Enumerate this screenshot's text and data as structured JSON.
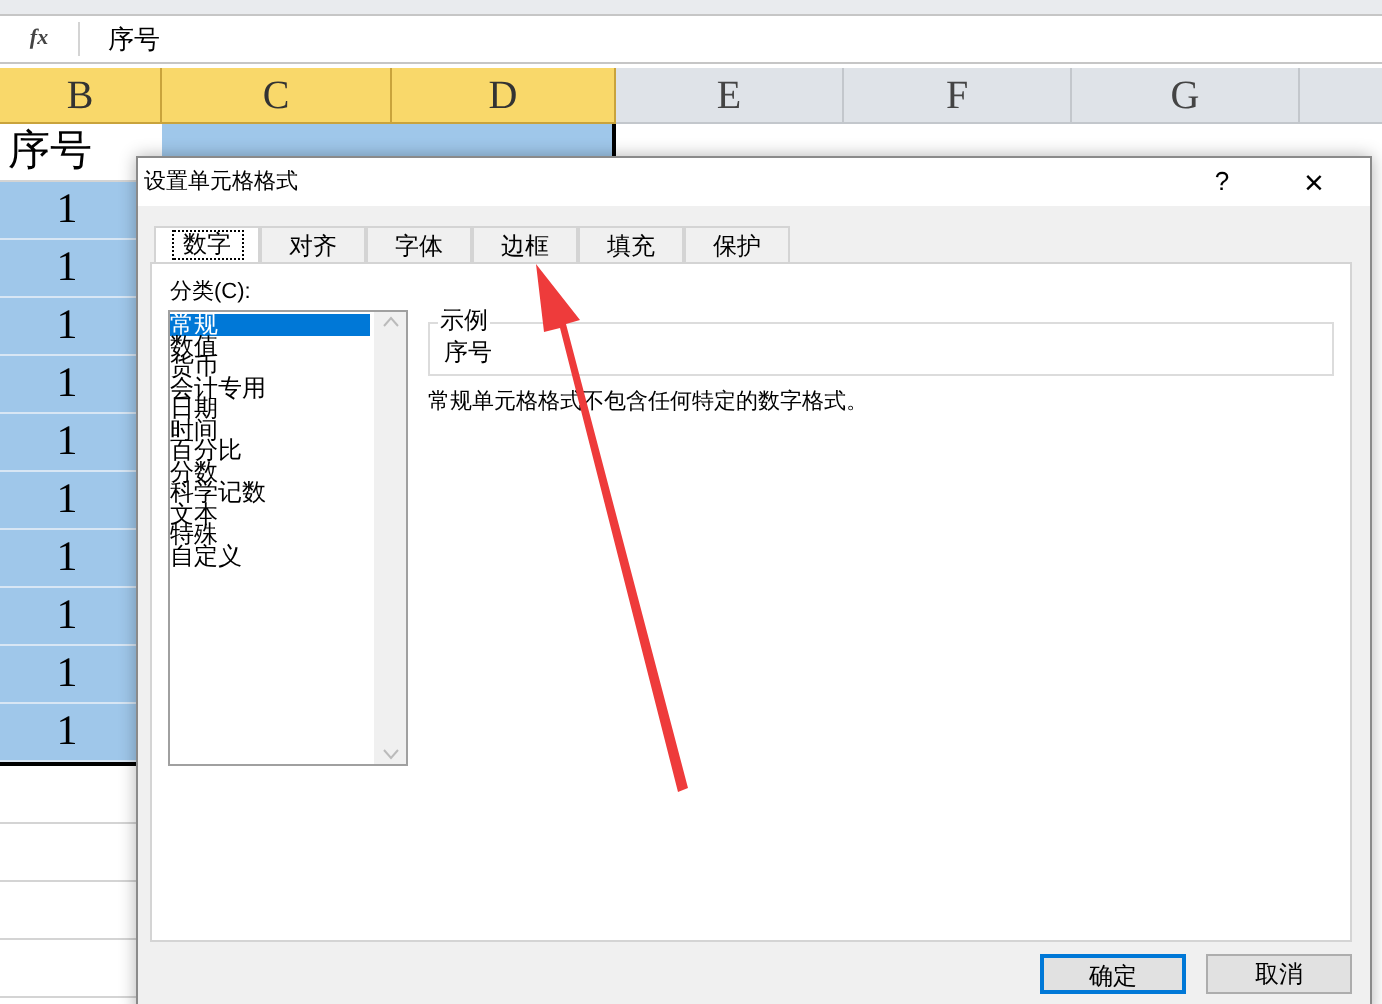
{
  "formula_bar": {
    "fx": "fx",
    "value": "序号"
  },
  "columns": [
    {
      "label": "B",
      "selected": true
    },
    {
      "label": "C",
      "selected": true
    },
    {
      "label": "D",
      "selected": true
    },
    {
      "label": "E",
      "selected": false
    },
    {
      "label": "F",
      "selected": false
    },
    {
      "label": "G",
      "selected": false
    }
  ],
  "column_b": [
    {
      "value": "序号",
      "selected": false
    },
    {
      "value": "1",
      "selected": true
    },
    {
      "value": "1",
      "selected": true
    },
    {
      "value": "1",
      "selected": true
    },
    {
      "value": "1",
      "selected": true
    },
    {
      "value": "1",
      "selected": true
    },
    {
      "value": "1",
      "selected": true
    },
    {
      "value": "1",
      "selected": true
    },
    {
      "value": "1",
      "selected": true
    },
    {
      "value": "1",
      "selected": true
    },
    {
      "value": "1",
      "selected": true
    }
  ],
  "dialog": {
    "title": "设置单元格格式",
    "help": "?",
    "close": "×",
    "tabs": [
      {
        "label": "数字",
        "selected": true
      },
      {
        "label": "对齐",
        "selected": false
      },
      {
        "label": "字体",
        "selected": false
      },
      {
        "label": "边框",
        "selected": false
      },
      {
        "label": "填充",
        "selected": false
      },
      {
        "label": "保护",
        "selected": false
      }
    ],
    "category_label": "分类(C):",
    "categories": [
      {
        "label": "常规",
        "selected": true
      },
      {
        "label": "数值",
        "selected": false
      },
      {
        "label": "货币",
        "selected": false
      },
      {
        "label": "会计专用",
        "selected": false
      },
      {
        "label": "日期",
        "selected": false
      },
      {
        "label": "时间",
        "selected": false
      },
      {
        "label": "百分比",
        "selected": false
      },
      {
        "label": "分数",
        "selected": false
      },
      {
        "label": "科学记数",
        "selected": false
      },
      {
        "label": "文本",
        "selected": false
      },
      {
        "label": "特殊",
        "selected": false
      },
      {
        "label": "自定义",
        "selected": false
      }
    ],
    "sample_label": "示例",
    "sample_value": "序号",
    "description": "常规单元格格式不包含任何特定的数字格式。",
    "buttons": [
      {
        "label": "确定",
        "primary": true
      },
      {
        "label": "取消",
        "primary": false
      }
    ]
  }
}
